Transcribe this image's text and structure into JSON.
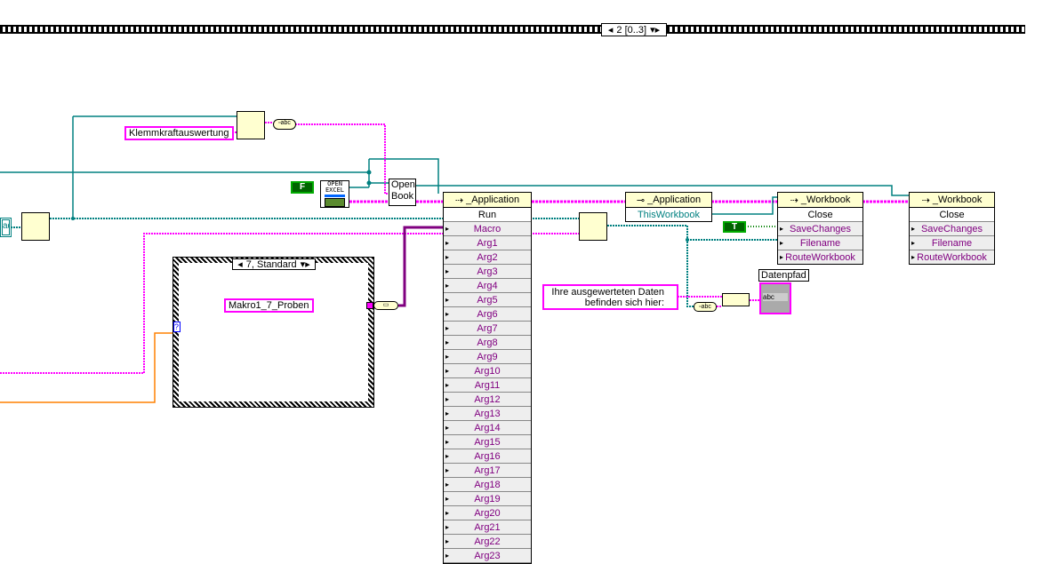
{
  "sequence": {
    "selector": "2 [0..3]"
  },
  "constants": {
    "klemm": "Klemmkraftauswertung",
    "bool_false": "F",
    "bool_true": "T",
    "macro_name": "Makro1_7_Proben",
    "message": "Ihre ausgewerteten Daten befinden sich hier:",
    "message_l1": "Ihre ausgewerteten Daten",
    "message_l2": "befinden sich hier:"
  },
  "left_terminal": "ad",
  "open_excel": {
    "line1": "OPEN",
    "line2": "EXCEL"
  },
  "open_book": {
    "line1": "Open",
    "line2": "Book"
  },
  "case_structure": {
    "selector": "7, Standard",
    "selector_terminal": "?"
  },
  "app_node": {
    "title": "_Application",
    "method": "Run",
    "params": [
      "Macro",
      "Arg1",
      "Arg2",
      "Arg3",
      "Arg4",
      "Arg5",
      "Arg6",
      "Arg7",
      "Arg8",
      "Arg9",
      "Arg10",
      "Arg11",
      "Arg12",
      "Arg13",
      "Arg14",
      "Arg15",
      "Arg16",
      "Arg17",
      "Arg18",
      "Arg19",
      "Arg20",
      "Arg21",
      "Arg22",
      "Arg23"
    ]
  },
  "app_prop": {
    "title": "_Application",
    "property": "ThisWorkbook"
  },
  "workbook1": {
    "title": "_Workbook",
    "method": "Close",
    "params": [
      "SaveChanges",
      "Filename",
      "RouteWorkbook"
    ]
  },
  "workbook2": {
    "title": "_Workbook",
    "method": "Close",
    "params": [
      "SaveChanges",
      "Filename",
      "RouteWorkbook"
    ]
  },
  "indicator": {
    "label": "Datenpfad",
    "value": "abc"
  },
  "colors": {
    "string": "#ff00ff",
    "refnum": "#008080",
    "numeric": "#ff8000",
    "variant": "#800080"
  }
}
